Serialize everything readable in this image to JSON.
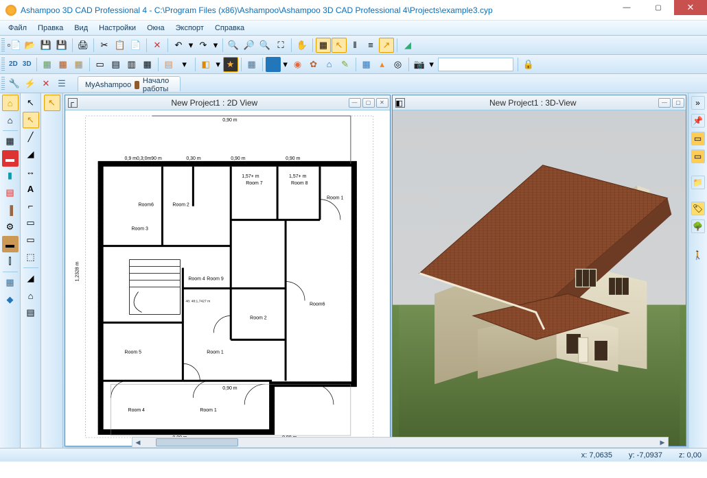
{
  "window": {
    "title": "Ashampoo 3D CAD Professional 4 - C:\\Program Files (x86)\\Ashampoo\\Ashampoo 3D CAD Professional 4\\Projects\\example3.cyp"
  },
  "menu": {
    "items": [
      "Файл",
      "Правка",
      "Вид",
      "Настройки",
      "Окна",
      "Экспорт",
      "Справка"
    ]
  },
  "toolbar2": {
    "mode2d": "2D",
    "mode3d": "3D"
  },
  "tabs": {
    "myashampoo": "MyAshampoo",
    "start": "Начало работы"
  },
  "views": {
    "view2d": {
      "title": "New Project1 : 2D View"
    },
    "view3d": {
      "title": "New Project1 : 3D-View"
    }
  },
  "plan": {
    "dim_top": "0,90 m",
    "dim_030a": "0,9 m0,3;0m90 m",
    "dim_030b": "0,30 m",
    "dim_left": "1,2328 m",
    "room1": "Room 1",
    "room2": "Room 2",
    "room3": "Room 3",
    "room4": "Room 4",
    "room5": "Room 5",
    "room6_a": "Room6",
    "room6_b": "Room6",
    "room7": "Room 7",
    "room8": "Room 8",
    "room9": "Room 9",
    "dim_152a": "1,57+ m",
    "dim_152b": "1,57+ m",
    "dim_172": "48: 48:1,7427 m"
  },
  "status": {
    "x": "x: 7,0635",
    "y": "y: -7,0937",
    "z": "z: 0,00"
  }
}
